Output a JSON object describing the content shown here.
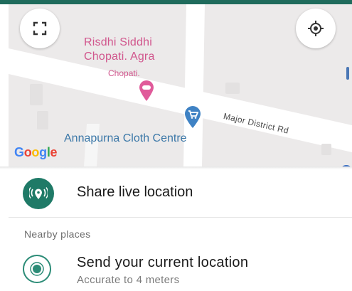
{
  "map": {
    "poi_name_line1": "Risdhi Siddhi",
    "poi_name_line2": "Chopati. Agra",
    "poi_small_label": "Chopati.",
    "shop_label": "Annapurna Cloth Centre",
    "road_label": "Major District Rd",
    "google_logo": [
      "G",
      "o",
      "o",
      "g",
      "l",
      "e"
    ],
    "fullscreen_icon": "fullscreen-icon",
    "locate_icon": "my-location-icon"
  },
  "sheet": {
    "share_label": "Share live location",
    "section_header": "Nearby places",
    "current": {
      "title": "Send your current location",
      "subtitle": "Accurate to 4 meters"
    }
  },
  "colors": {
    "accent": "#1f7a67",
    "poi": "#d1568d",
    "shop": "#3c78a8",
    "map_bg": "#eceaea"
  }
}
